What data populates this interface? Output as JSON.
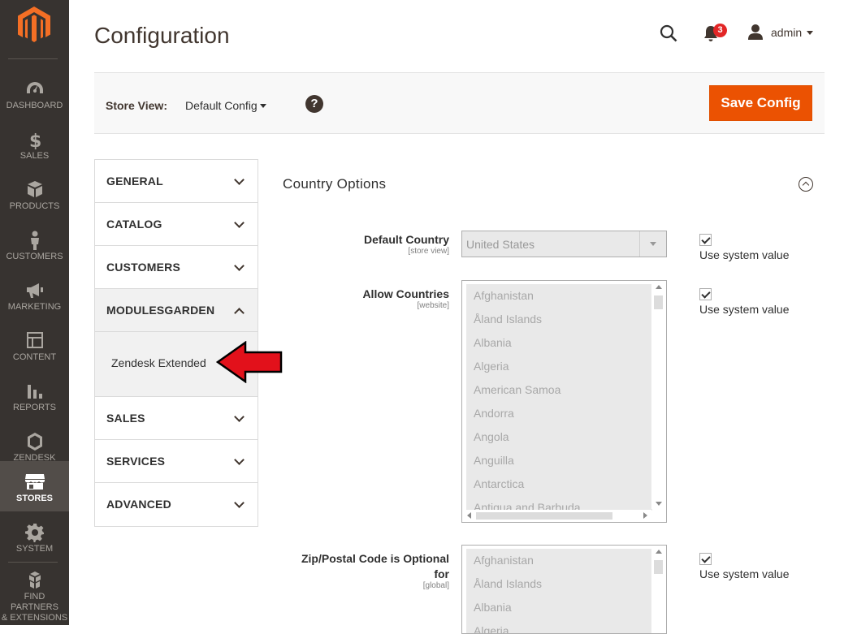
{
  "sidebar": {
    "items": [
      {
        "label": "DASHBOARD",
        "icon": "dashboard-icon"
      },
      {
        "label": "SALES",
        "icon": "dollar-icon"
      },
      {
        "label": "PRODUCTS",
        "icon": "box-icon"
      },
      {
        "label": "CUSTOMERS",
        "icon": "person-icon"
      },
      {
        "label": "MARKETING",
        "icon": "megaphone-icon"
      },
      {
        "label": "CONTENT",
        "icon": "layout-icon"
      },
      {
        "label": "REPORTS",
        "icon": "bar-chart-icon"
      },
      {
        "label": "ZENDESK",
        "icon": "hexagon-icon"
      },
      {
        "label": "STORES",
        "icon": "store-icon"
      },
      {
        "label": "SYSTEM",
        "icon": "gear-icon"
      },
      {
        "label_line1": "FIND PARTNERS",
        "label_line2": "& EXTENSIONS",
        "icon": "cubes-icon"
      }
    ],
    "active": "STORES"
  },
  "header": {
    "title": "Configuration",
    "notifications_count": "3",
    "user": "admin"
  },
  "toolbar": {
    "store_view_label": "Store View:",
    "store_view_value": "Default Config",
    "help": "?",
    "save_label": "Save Config"
  },
  "tabs": {
    "general": "GENERAL",
    "catalog": "CATALOG",
    "customers": "CUSTOMERS",
    "modulesgarden": "MODULESGARDEN",
    "zendesk_extended": "Zendesk Extended",
    "sales": "SALES",
    "services": "SERVICES",
    "advanced": "ADVANCED"
  },
  "section": {
    "title": "Country Options",
    "fields": {
      "default_country": {
        "label": "Default Country",
        "scope": "[store view]",
        "value": "United States",
        "use_system": "Use system value"
      },
      "allow_countries": {
        "label": "Allow Countries",
        "scope": "[website]",
        "use_system": "Use system value",
        "options": [
          "Afghanistan",
          "Åland Islands",
          "Albania",
          "Algeria",
          "American Samoa",
          "Andorra",
          "Angola",
          "Anguilla",
          "Antarctica",
          "Antigua and Barbuda"
        ]
      },
      "zip_optional": {
        "label_line1": "Zip/Postal Code is Optional",
        "label_line2": "for",
        "scope": "[global]",
        "use_system": "Use system value",
        "options": [
          "Afghanistan",
          "Åland Islands",
          "Albania",
          "Algeria"
        ]
      }
    }
  },
  "colors": {
    "sidebar_bg": "#373330",
    "accent": "#eb5202",
    "arrow": "#e2111b"
  }
}
